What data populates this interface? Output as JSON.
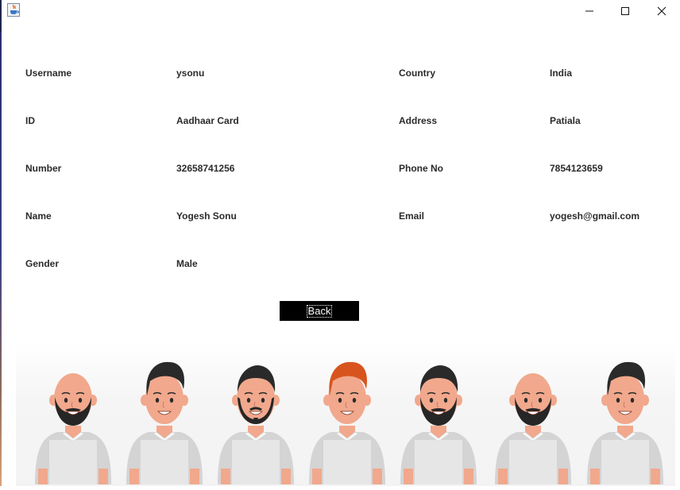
{
  "window": {
    "icons": {
      "app": "java-cup-icon",
      "minimize": "minimize-icon",
      "maximize": "maximize-icon",
      "close": "close-icon"
    }
  },
  "profile": {
    "left": [
      {
        "label": "Username",
        "value": "ysonu"
      },
      {
        "label": "ID",
        "value": "Aadhaar Card"
      },
      {
        "label": "Number",
        "value": "32658741256"
      },
      {
        "label": "Name",
        "value": "Yogesh Sonu"
      },
      {
        "label": "Gender",
        "value": "Male"
      }
    ],
    "right": [
      {
        "label": "Country",
        "value": "India"
      },
      {
        "label": "Address",
        "value": "Patiala"
      },
      {
        "label": "Phone No",
        "value": "7854123659"
      },
      {
        "label": "Email",
        "value": "yogesh@gmail.com"
      }
    ]
  },
  "back_button": {
    "label": "Back"
  },
  "illustration": {
    "people": [
      {
        "hair": "bald",
        "beard": "full",
        "name": "person-bald-beard-icon"
      },
      {
        "hair": "dark-quiff",
        "beard": "none",
        "name": "person-quiff-icon"
      },
      {
        "hair": "dark-short",
        "beard": "goatee",
        "name": "person-goatee-icon"
      },
      {
        "hair": "red-quiff",
        "beard": "none",
        "name": "person-redhead-icon"
      },
      {
        "hair": "dark-short",
        "beard": "full",
        "name": "person-full-beard-icon"
      },
      {
        "hair": "bald",
        "beard": "full",
        "name": "person-bald-beard-icon"
      },
      {
        "hair": "dark-quiff",
        "beard": "none",
        "name": "person-quiff-icon"
      }
    ],
    "colors": {
      "skin": "#f1a88c",
      "shirt": "#e6e6e6",
      "sleeve": "#d4d4d4",
      "hair_dark": "#2a2a2a",
      "hair_red": "#d8541f",
      "beard": "#262626"
    }
  }
}
